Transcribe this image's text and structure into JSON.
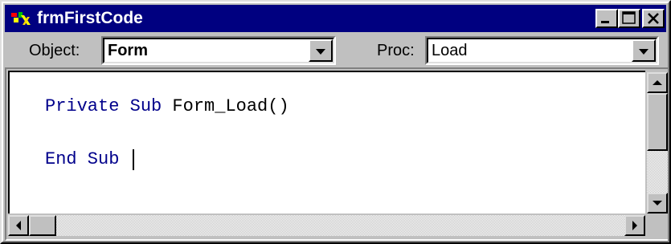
{
  "window": {
    "title": "frmFirstCode",
    "buttons": [
      "minimize",
      "maximize",
      "close"
    ]
  },
  "toolbar": {
    "object_label": "Object:",
    "object_value": "Form",
    "proc_label": "Proc:",
    "proc_value": "Load"
  },
  "code": {
    "lines": [
      {
        "keyword": "Private Sub",
        "rest": " Form_Load()"
      },
      {
        "keyword": "End Sub",
        "rest": ""
      }
    ]
  },
  "icons": {
    "app": "vb-app-icon",
    "minimize": "minimize-icon",
    "maximize": "maximize-icon",
    "close": "close-icon",
    "dropdown": "chevron-down-icon",
    "scroll_up": "arrow-up-icon",
    "scroll_down": "arrow-down-icon",
    "scroll_left": "arrow-left-icon",
    "scroll_right": "arrow-right-icon"
  },
  "colors": {
    "title_bar": "#000080",
    "keyword": "#00008b",
    "face": "#c0c0c0"
  }
}
